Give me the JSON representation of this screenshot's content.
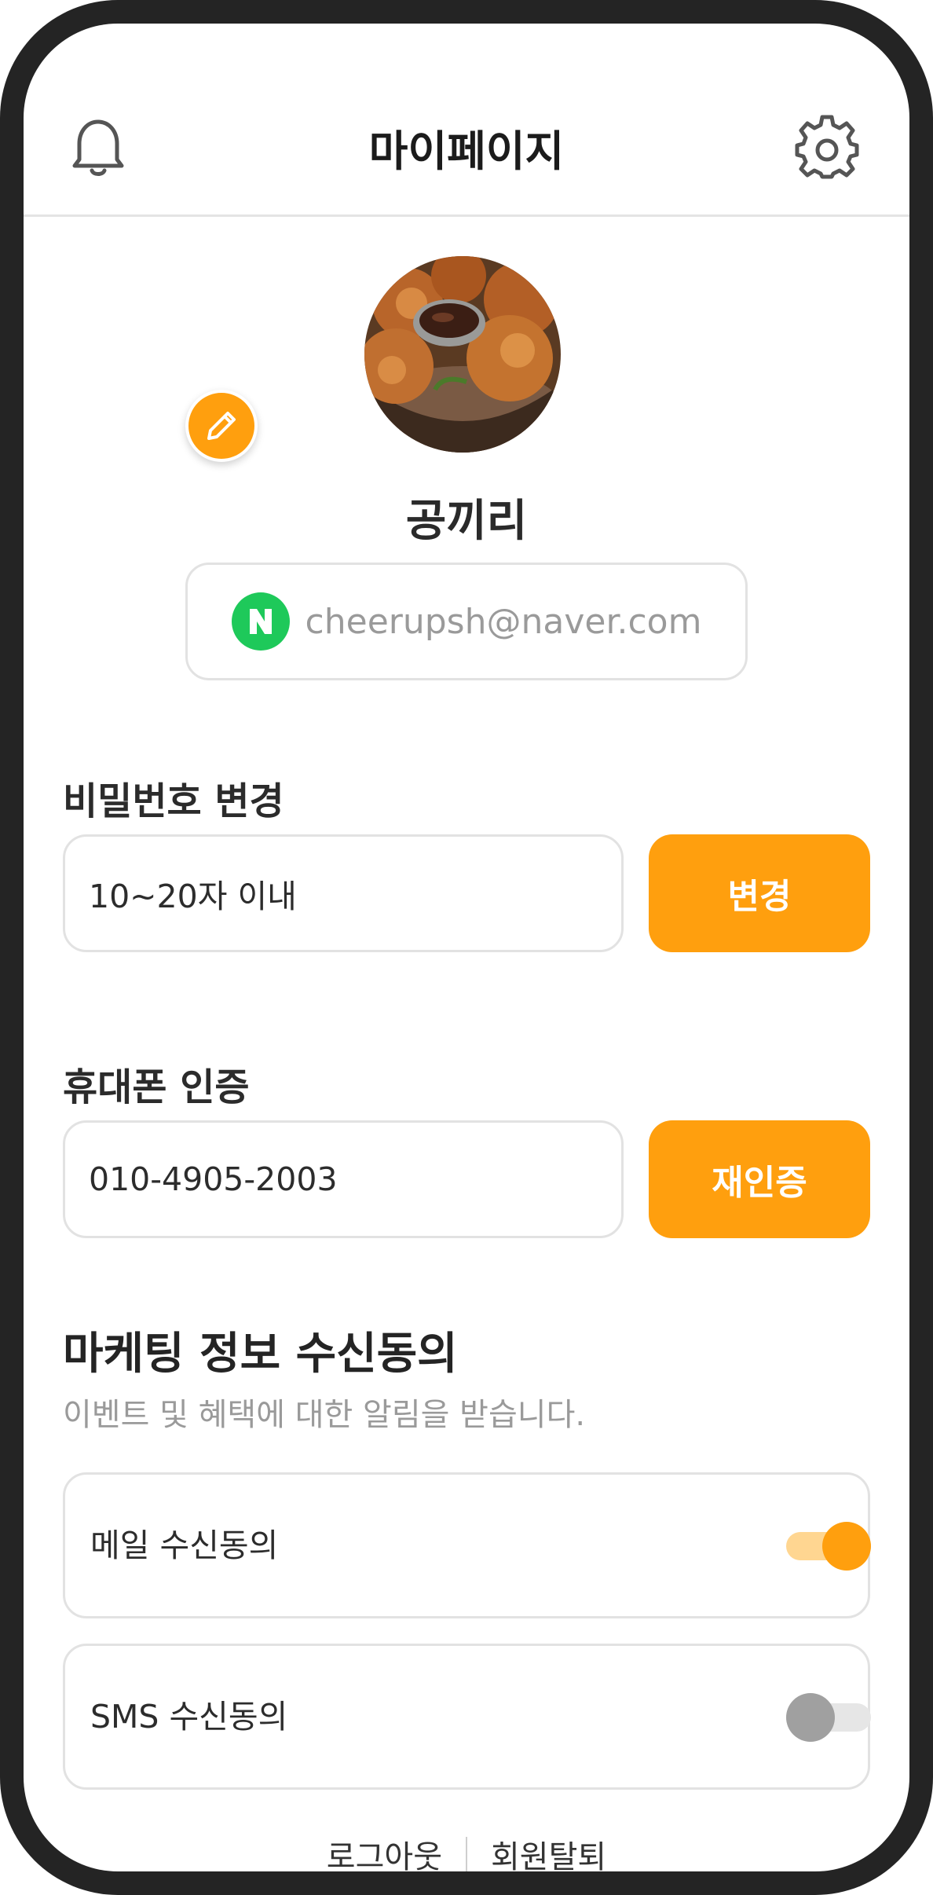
{
  "header": {
    "title": "마이페이지",
    "left_icon": "bell-icon",
    "right_icon": "gear-icon"
  },
  "profile": {
    "nickname": "공끼리",
    "avatar_description": "fried-chicken-photo",
    "edit_icon": "pencil-icon",
    "login_provider_letter": "N",
    "email": "cheerupsh@naver.com"
  },
  "password": {
    "label": "비밀번호 변경",
    "placeholder": "10~20자 이내",
    "button": "변경"
  },
  "phone": {
    "label": "휴대폰 인증",
    "value": "010-4905-2003",
    "button": "재인증"
  },
  "marketing": {
    "title": "마케팅 정보 수신동의",
    "subtitle": "이벤트 및 혜택에 대한 알림을 받습니다.",
    "items": [
      {
        "label": "메일 수신동의",
        "enabled": true
      },
      {
        "label": "SMS 수신동의",
        "enabled": false
      }
    ]
  },
  "footer": {
    "logout": "로그아웃",
    "withdraw": "회원탈퇴"
  },
  "colors": {
    "accent": "#ff9f0e",
    "naver_green": "#1ec95a",
    "border": "#e2e2e2"
  }
}
